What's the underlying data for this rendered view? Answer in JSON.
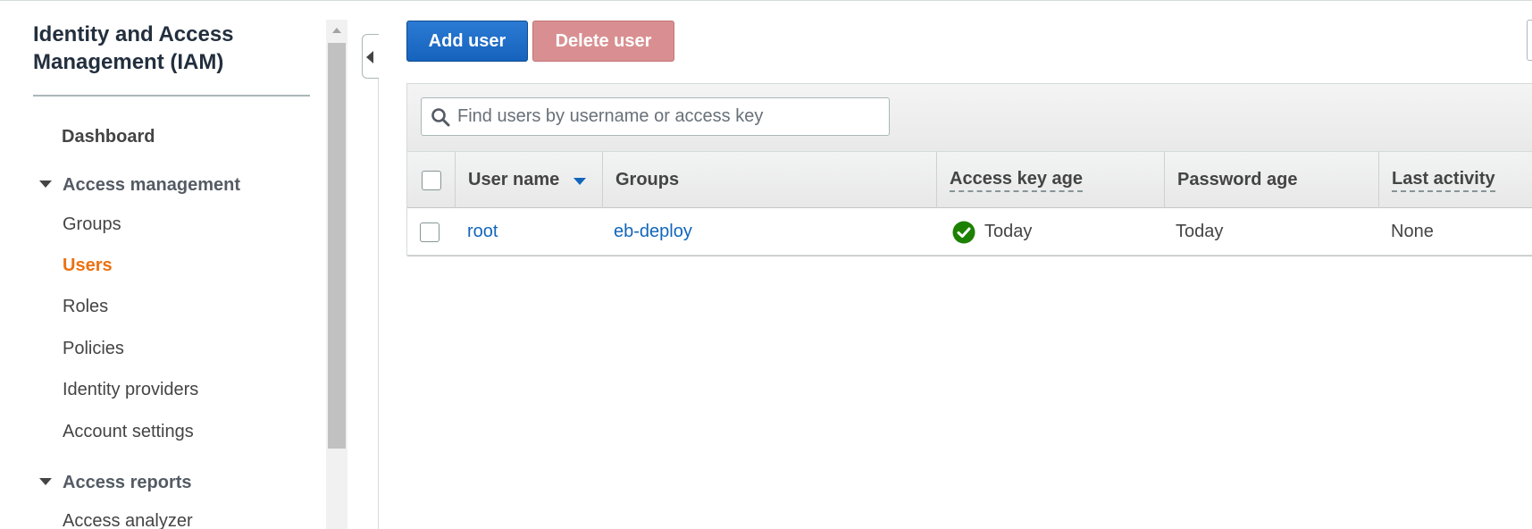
{
  "sidebar": {
    "title": "Identity and Access Management (IAM)",
    "dashboard": "Dashboard",
    "access_management": {
      "label": "Access management",
      "items": [
        "Groups",
        "Users",
        "Roles",
        "Policies",
        "Identity providers",
        "Account settings"
      ],
      "active": "Users"
    },
    "access_reports": {
      "label": "Access reports",
      "items": [
        "Access analyzer"
      ]
    }
  },
  "toolbar": {
    "add_user": "Add user",
    "delete_user": "Delete user"
  },
  "search": {
    "placeholder": "Find users by username or access key",
    "value": ""
  },
  "table": {
    "columns": [
      "User name",
      "Groups",
      "Access key age",
      "Password age",
      "Last activity"
    ],
    "sorted_column": "User name",
    "rows": [
      {
        "user_name": "root",
        "groups": "eb-deploy",
        "access_key_age": "Today",
        "password_age": "Today",
        "last_activity": "None"
      }
    ]
  },
  "colors": {
    "primary": "#1663bd",
    "danger_disabled": "#d98f91",
    "active_nav": "#ec7211",
    "link": "#1166bb",
    "ok": "#1d8102"
  }
}
